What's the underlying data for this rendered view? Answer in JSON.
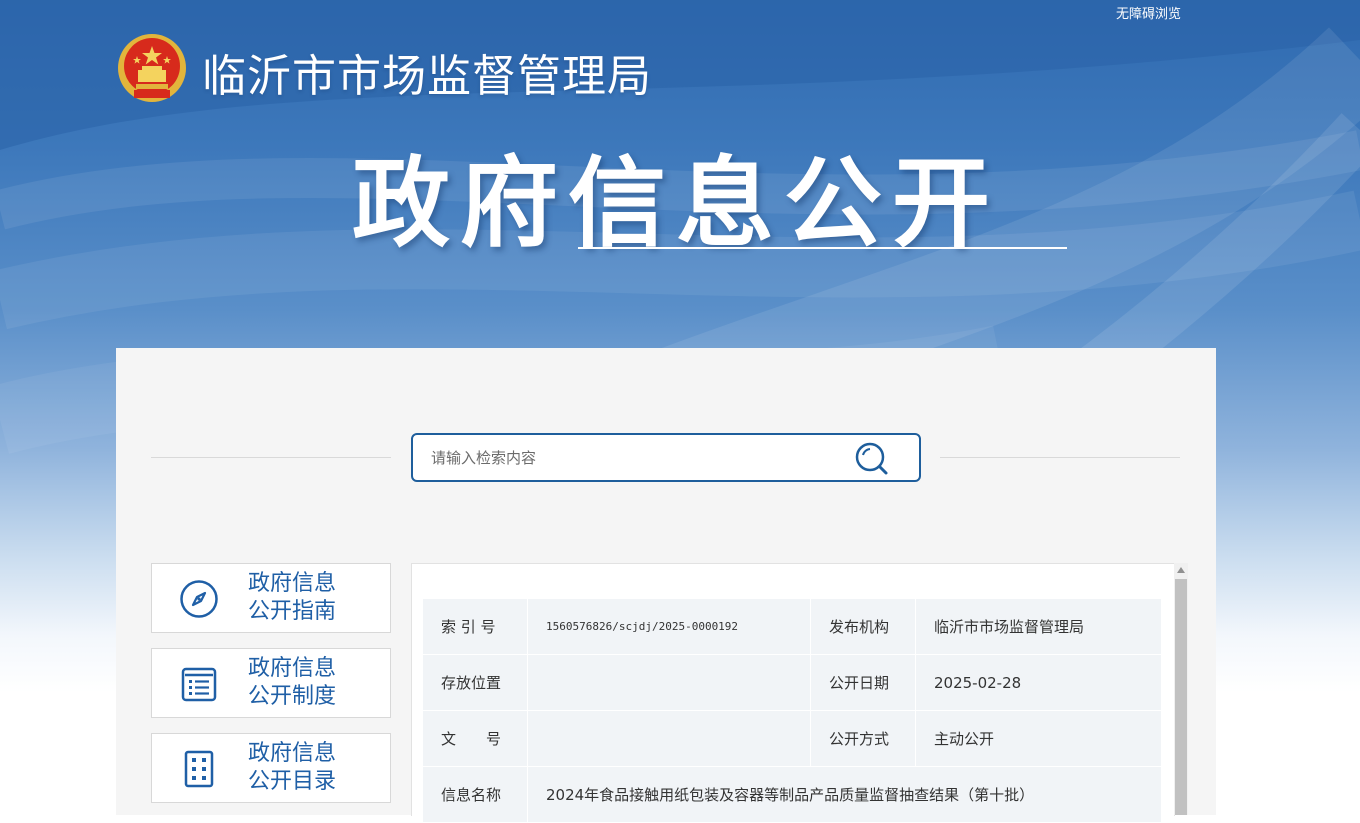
{
  "header": {
    "accessibility_link": "无障碍浏览",
    "org_name": "临沂市市场监督管理局",
    "title": "政府信息公开",
    "emblem_icon": "national-emblem-icon"
  },
  "search": {
    "placeholder": "请输入检索内容",
    "button_icon": "search-icon"
  },
  "nav": [
    {
      "line1": "政府信息",
      "line2": "公开指南",
      "icon": "compass-icon"
    },
    {
      "line1": "政府信息",
      "line2": "公开制度",
      "icon": "document-list-icon"
    },
    {
      "line1": "政府信息",
      "line2": "公开目录",
      "icon": "catalog-grid-icon"
    }
  ],
  "info": {
    "index_label": "索 引 号",
    "index_value": "1560576826/scjdj/2025-0000192",
    "publisher_label": "发布机构",
    "publisher_value": "临沂市市场监督管理局",
    "location_label": "存放位置",
    "location_value": "",
    "date_label": "公开日期",
    "date_value": "2025-02-28",
    "docno_label": "文　　号",
    "docno_value": "",
    "mode_label": "公开方式",
    "mode_value": "主动公开",
    "name_label": "信息名称",
    "name_value": "2024年食品接触用纸包装及容器等制品产品质量监督抽查结果（第十批）"
  },
  "colors": {
    "brand_blue": "#1f5fa6",
    "search_border": "#1e5e9c",
    "table_cell": "#f1f4f7",
    "panel_bg": "#f5f5f5"
  }
}
